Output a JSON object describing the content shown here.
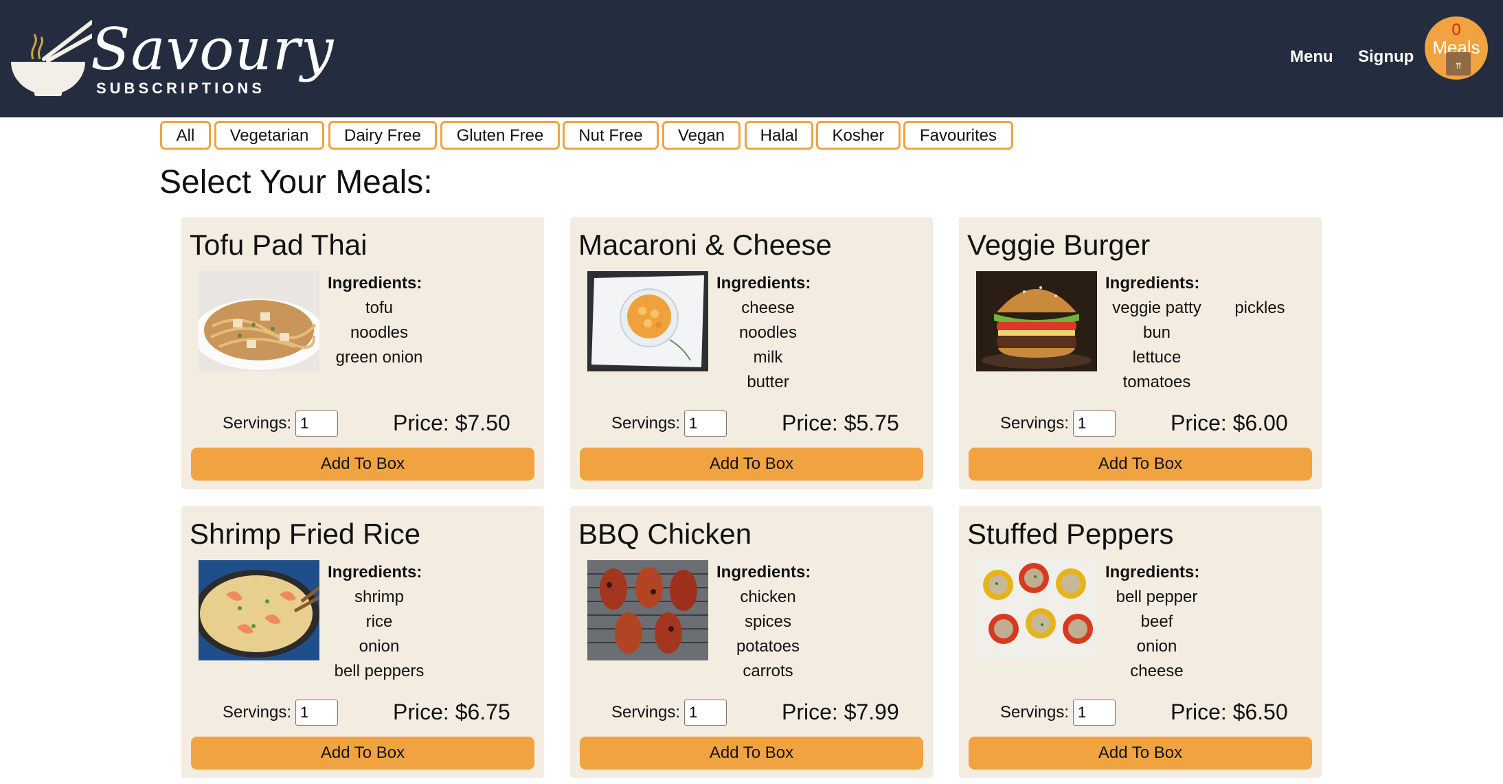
{
  "header": {
    "logo_word": "Savoury",
    "logo_sub": "SUBSCRIPTIONS",
    "nav": {
      "menu": "Menu",
      "signup": "Signup"
    },
    "cart": {
      "count": "0",
      "label": "Meals"
    }
  },
  "filters": [
    "All",
    "Vegetarian",
    "Dairy Free",
    "Gluten Free",
    "Nut Free",
    "Vegan",
    "Halal",
    "Kosher",
    "Favourites"
  ],
  "page_title": "Select Your Meals:",
  "labels": {
    "ingredients": "Ingredients:",
    "servings": "Servings:",
    "add_to_box": "Add To Box"
  },
  "meals": [
    {
      "name": "Tofu Pad Thai",
      "ingredients": [
        "tofu",
        "noodles",
        "green onion"
      ],
      "servings": "1",
      "price": "Price: $7.50",
      "image": "pad-thai"
    },
    {
      "name": "Macaroni & Cheese",
      "ingredients": [
        "cheese",
        "noodles",
        "milk",
        "butter"
      ],
      "servings": "1",
      "price": "Price: $5.75",
      "image": "mac-and-cheese"
    },
    {
      "name": "Veggie Burger",
      "ingredients": [
        "veggie patty",
        "bun",
        "lettuce",
        "tomatoes",
        "pickles"
      ],
      "servings": "1",
      "price": "Price: $6.00",
      "image": "veggie-burger"
    },
    {
      "name": "Shrimp Fried Rice",
      "ingredients": [
        "shrimp",
        "rice",
        "onion",
        "bell peppers"
      ],
      "servings": "1",
      "price": "Price: $6.75",
      "image": "shrimp-fried-rice"
    },
    {
      "name": "BBQ Chicken",
      "ingredients": [
        "chicken",
        "spices",
        "potatoes",
        "carrots"
      ],
      "servings": "1",
      "price": "Price: $7.99",
      "image": "bbq-chicken"
    },
    {
      "name": "Stuffed Peppers",
      "ingredients": [
        "bell pepper",
        "beef",
        "onion",
        "cheese"
      ],
      "servings": "1",
      "price": "Price: $6.50",
      "image": "stuffed-peppers"
    }
  ],
  "colors": {
    "header_bg": "#232d3f",
    "accent": "#f0a340",
    "card_bg": "#f3ece0"
  }
}
